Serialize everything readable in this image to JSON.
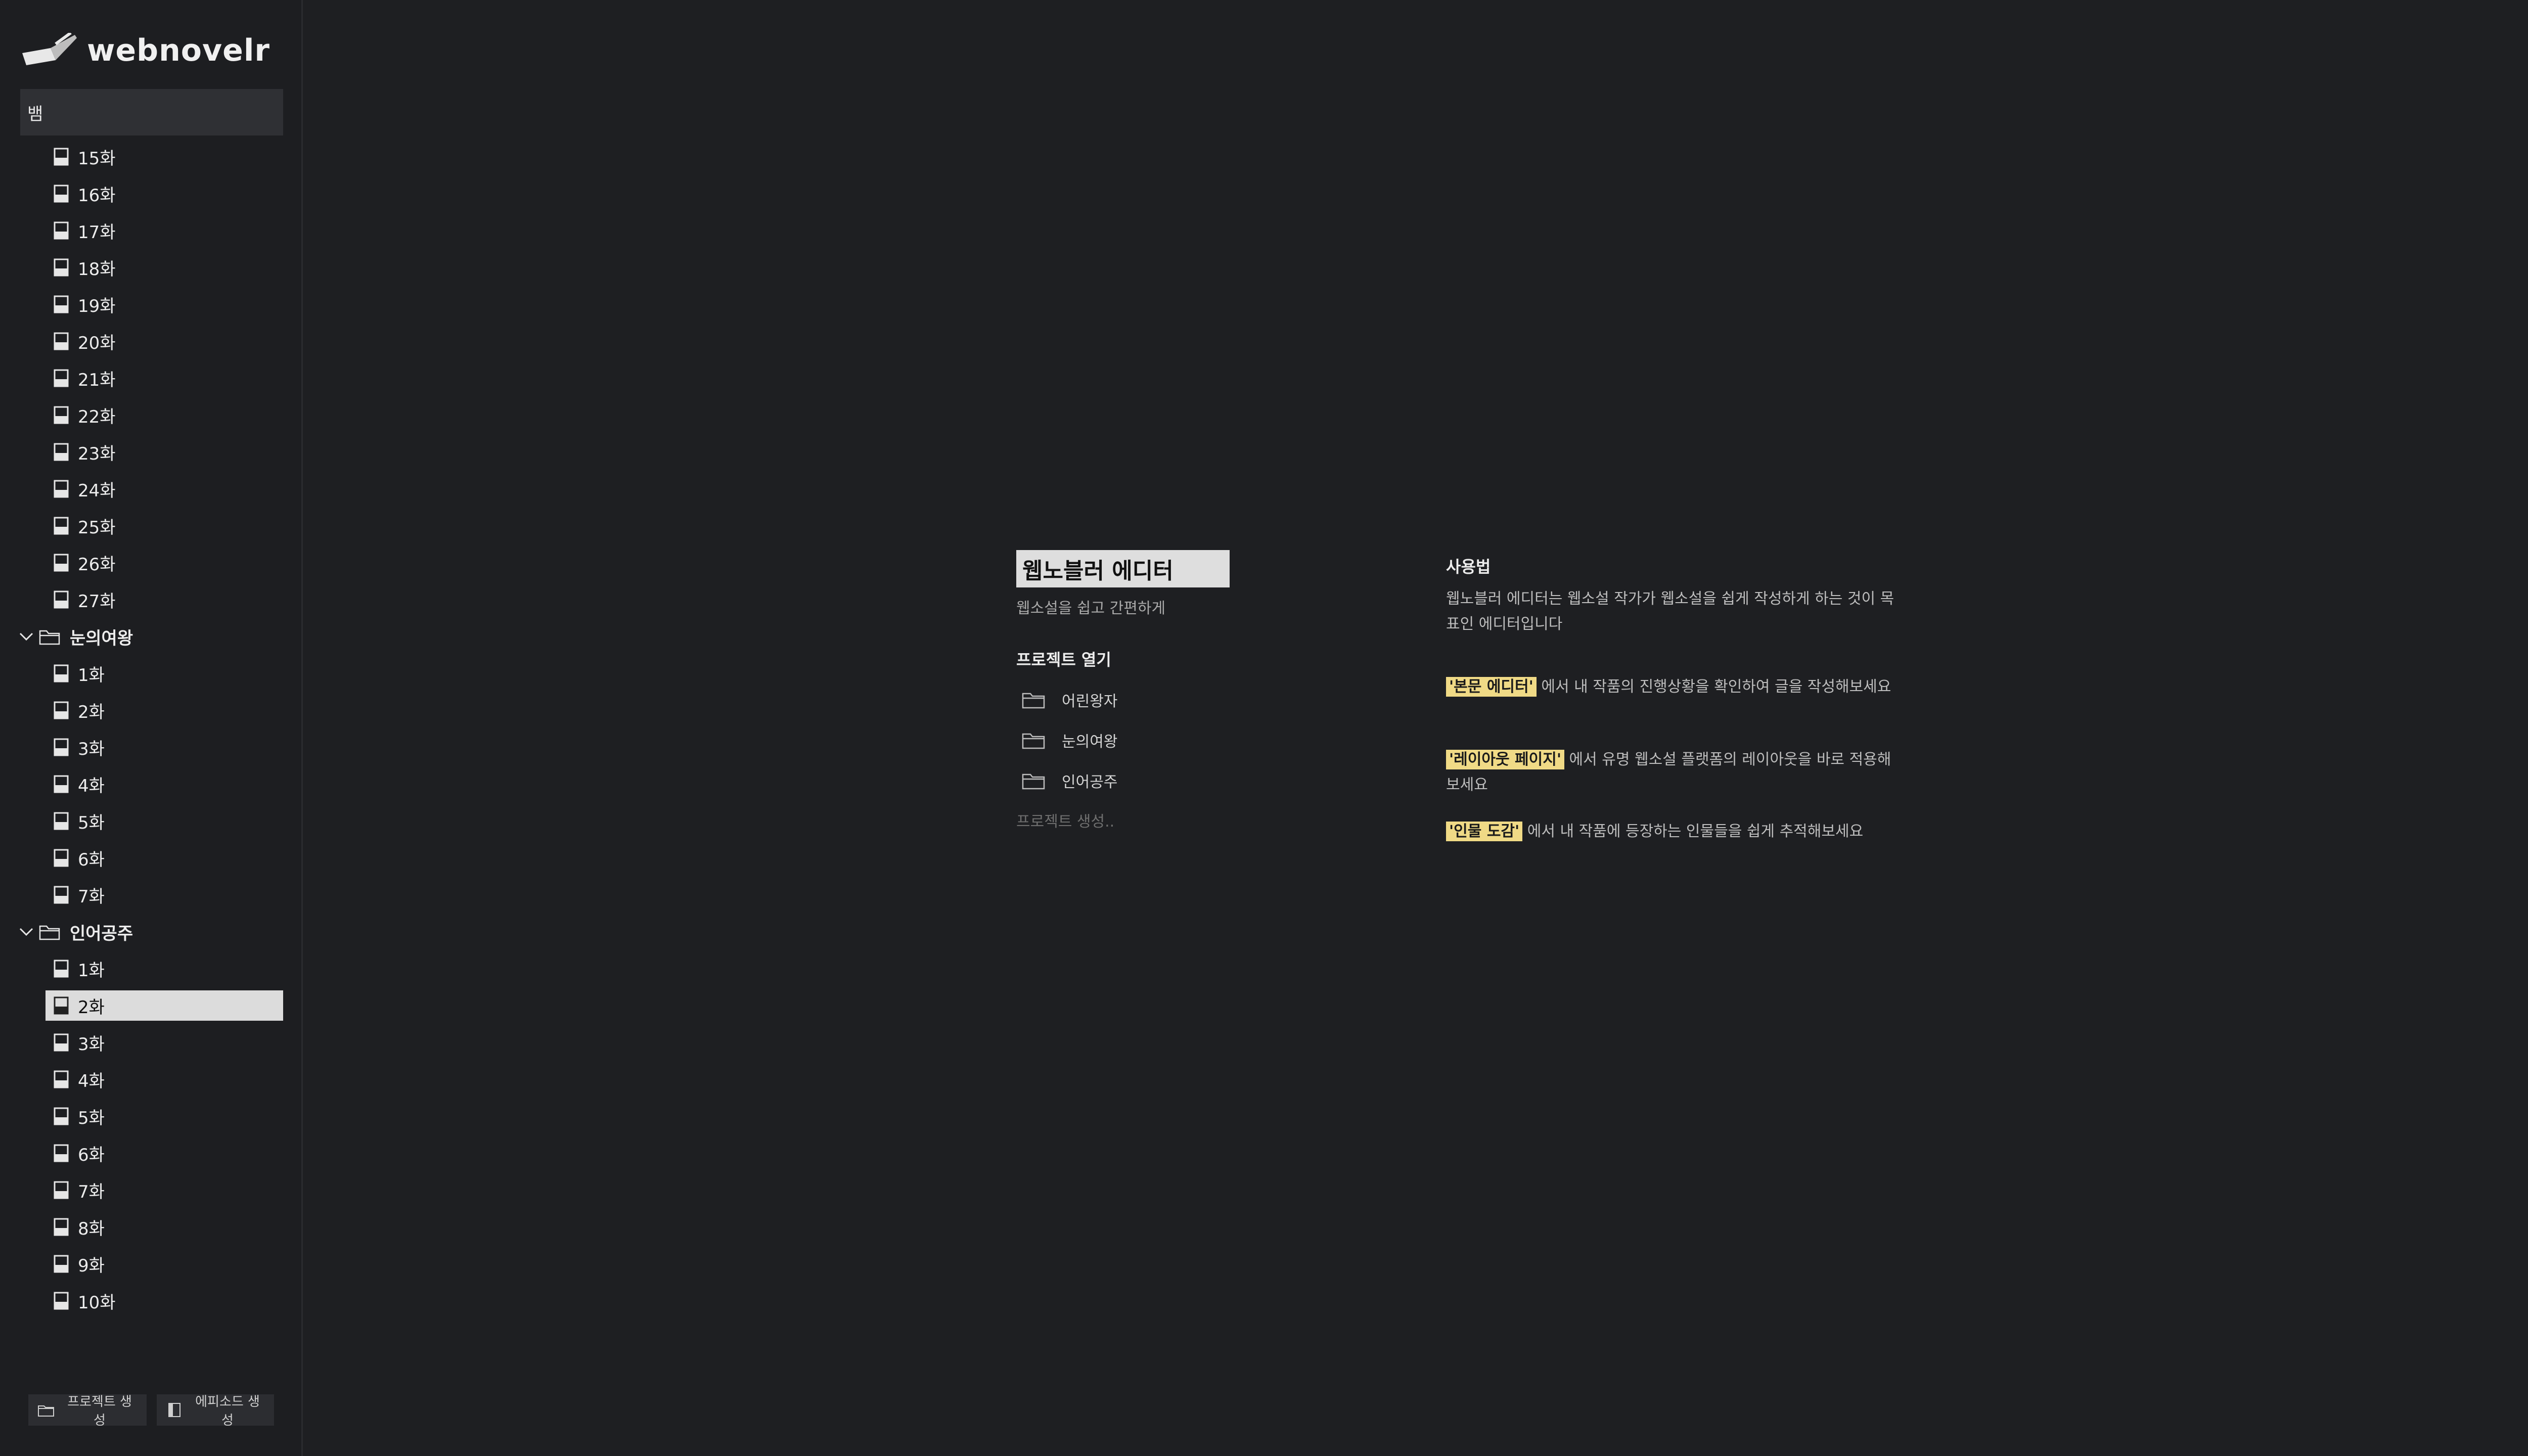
{
  "app": {
    "name": "webnovelr"
  },
  "search": {
    "value": "뱀"
  },
  "sidebar": {
    "groups": [
      {
        "type": "episodes",
        "episodes": [
          "15화",
          "16화",
          "17화",
          "18화",
          "19화",
          "20화",
          "21화",
          "22화",
          "23화",
          "24화",
          "25화",
          "26화",
          "27화"
        ]
      },
      {
        "type": "folder",
        "name": "눈의여왕",
        "episodes": [
          "1화",
          "2화",
          "3화",
          "4화",
          "5화",
          "6화",
          "7화"
        ]
      },
      {
        "type": "folder",
        "name": "인어공주",
        "episodes": [
          "1화",
          "2화",
          "3화",
          "4화",
          "5화",
          "6화",
          "7화",
          "8화",
          "9화",
          "10화"
        ],
        "selected_index": 1
      }
    ],
    "buttons": {
      "new_project": "프로젝트 생성",
      "new_episode": "에피소드 생성"
    }
  },
  "main": {
    "title": "웹노블러 에디터",
    "subtitle": "웹소설을 쉽고 간편하게",
    "open_heading": "프로젝트 열기",
    "projects": [
      "어린왕자",
      "눈의여왕",
      "인어공주"
    ],
    "create_link": "프로젝트 생성..",
    "usage": {
      "heading": "사용법",
      "intro": "웹노블러 에디터는 웹소설 작가가 웹소설을 쉽게 작성하게 하는 것이 목표인 에디터입니다",
      "tips": [
        {
          "highlight": "'본문 에디터'",
          "text": " 에서 내 작품의 진행상황을 확인하여 글을 작성해보세요"
        },
        {
          "highlight": "'레이아웃 페이지'",
          "text": " 에서 유명 웹소설 플랫폼의 레이아웃을 바로 적용해보세요"
        },
        {
          "highlight": "'인물 도감'",
          "text": " 에서 내 작품에 등장하는 인물들을 쉽게 추적해보세요"
        }
      ]
    }
  },
  "colors": {
    "background": "#1e1f22",
    "highlight": "#f0da86",
    "selected": "#dcdcdc"
  },
  "icons": {
    "episode": "document-icon",
    "folder": "folder-icon",
    "expand": "chevron-down-icon"
  }
}
